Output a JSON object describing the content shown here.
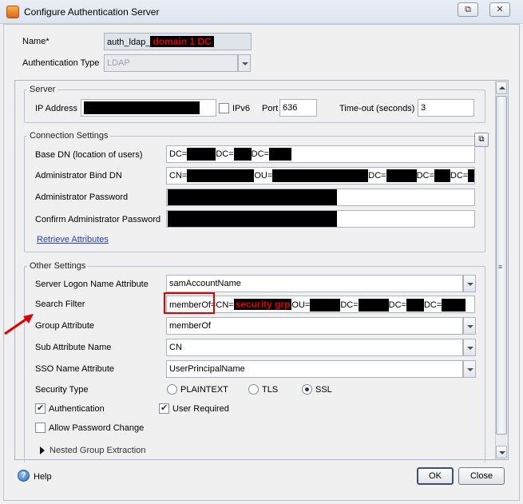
{
  "window": {
    "title": "Configure Authentication Server",
    "restore_label": "⧉",
    "close_label": "✕"
  },
  "general": {
    "name_label": "Name*",
    "name_value": "auth_ldap_",
    "name_annotation": "domain 1 DC",
    "auth_type_label": "Authentication Type",
    "auth_type_value": "LDAP"
  },
  "server": {
    "legend": "Server",
    "ip_label": "IP Address",
    "ipv6_label": "IPv6",
    "port_label": "Port",
    "port_value": "636",
    "timeout_label": "Time-out (seconds)",
    "timeout_value": "3"
  },
  "connection": {
    "legend": "Connection Settings",
    "base_dn_label": "Base DN (location of users)",
    "base_dn_parts": [
      "DC=",
      "DC=",
      "DC="
    ],
    "bind_dn_label": "Administrator Bind DN",
    "bind_dn_parts": [
      "CN=",
      "OU=",
      "DC=",
      "DC=",
      "DC="
    ],
    "password_label": "Administrator Password",
    "confirm_label": "Confirm Administrator Password",
    "retrieve_link": "Retrieve Attributes"
  },
  "other": {
    "legend": "Other Settings",
    "logon_attr_label": "Server Logon Name Attribute",
    "logon_attr_value": "samAccountName",
    "search_filter_label": "Search Filter",
    "search_filter_prefix": "memberOf=",
    "search_filter_cn": "CN=",
    "search_filter_annotation": "security grp",
    "search_filter_parts": [
      "OU=",
      "DC=",
      "DC=",
      "DC="
    ],
    "group_attr_label": "Group Attribute",
    "group_attr_value": "memberOf",
    "sub_attr_label": "Sub Attribute Name",
    "sub_attr_value": "CN",
    "sso_label": "SSO Name Attribute",
    "sso_value": "UserPrincipalName",
    "security_type_label": "Security Type",
    "security_options": [
      "PLAINTEXT",
      "TLS",
      "SSL"
    ],
    "security_selected": "SSL",
    "authentication_label": "Authentication",
    "authentication_checked": true,
    "user_required_label": "User Required",
    "user_required_checked": true,
    "allow_pw_change_label": "Allow Password Change",
    "allow_pw_change_checked": false,
    "nested_group_label": "Nested Group Extraction"
  },
  "footer": {
    "help_label": "Help",
    "ok_label": "OK",
    "close_label": "Close"
  },
  "colors": {
    "annotation_red": "#e00000",
    "link_blue": "#1f3fbf"
  }
}
